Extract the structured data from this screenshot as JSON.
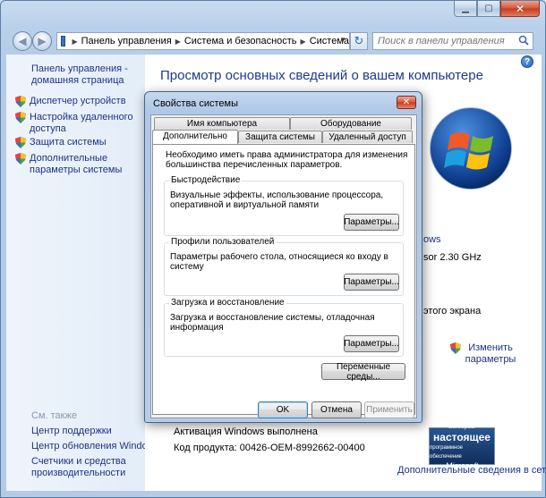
{
  "window": {
    "controls": {
      "minimize": "▁",
      "maximize": "▢",
      "close": "✕"
    }
  },
  "address": {
    "crumbs": [
      "Панель управления",
      "Система и безопасность",
      "Система"
    ],
    "search_placeholder": "Поиск в панели управления"
  },
  "sidebar": {
    "home_link": "Панель управления - домашняя страница",
    "tasks": [
      "Диспетчер устройств",
      "Настройка удаленного доступа",
      "Защита системы",
      "Дополнительные параметры системы"
    ],
    "see_also_title": "См. также",
    "see_also": [
      "Центр поддержки",
      "Центр обновления Windows",
      "Счетчики и средства производительности"
    ]
  },
  "main": {
    "title": "Просмотр основных сведений о вашем компьютере",
    "partial_windows": "ows",
    "partial_processor": "sor  2.30 GHz",
    "partial_screen": "этого экрана",
    "change_params": "Изменить параметры",
    "activation": "Активация Windows выполнена",
    "product_code": "Код продукта: 00426-OEM-8992662-00400",
    "more_info_link": "Дополнительные сведения в сети...",
    "genuine_badge": {
      "line1": "Выбирай",
      "line2": "настоящее",
      "line3": "программное обеспечение",
      "line4": "Microsoft"
    }
  },
  "dialog": {
    "title": "Свойства системы",
    "close_label": "✕",
    "tabs_row1": [
      "Имя компьютера",
      "Оборудование"
    ],
    "tabs_row2": [
      "Дополнительно",
      "Защита системы",
      "Удаленный доступ"
    ],
    "active_tab": "Дополнительно",
    "note": "Необходимо иметь права администратора для изменения большинства перечисленных параметров.",
    "groups": [
      {
        "label": "Быстродействие",
        "text": "Визуальные эффекты, использование процессора, оперативной и виртуальной памяти",
        "button": "Параметры..."
      },
      {
        "label": "Профили пользователей",
        "text": "Параметры рабочего стола, относящиеся ко входу в систему",
        "button": "Параметры..."
      },
      {
        "label": "Загрузка и восстановление",
        "text": "Загрузка и восстановление системы, отладочная информация",
        "button": "Параметры..."
      }
    ],
    "env_button": "Переменные среды...",
    "ok": "OK",
    "cancel": "Отмена",
    "apply": "Применить"
  }
}
